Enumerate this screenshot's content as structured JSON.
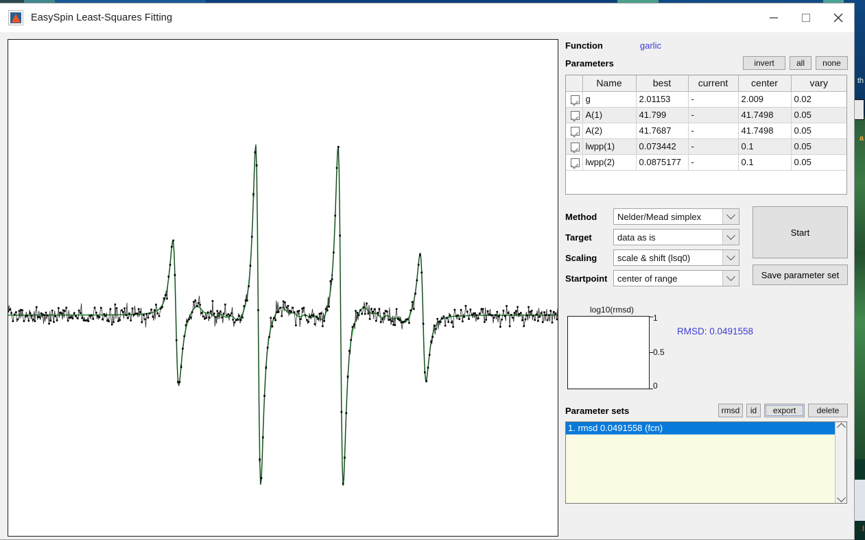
{
  "window": {
    "title": "EasySpin Least-Squares Fitting",
    "minimize_label": "minimize-button",
    "maximize_label": "maximize-button",
    "close_label": "close-button"
  },
  "right": {
    "function_label": "Function",
    "function_value": "garlic",
    "parameters_label": "Parameters",
    "param_buttons": {
      "invert": "invert",
      "all": "all",
      "none": "none"
    },
    "table": {
      "headers": [
        "",
        "Name",
        "best",
        "current",
        "center",
        "vary"
      ],
      "rows": [
        {
          "checked": true,
          "name": "g",
          "best": "2.01153",
          "current": "-",
          "center": "2.009",
          "vary": "0.02"
        },
        {
          "checked": true,
          "name": "A(1)",
          "best": "41.799",
          "current": "-",
          "center": "41.7498",
          "vary": "0.05"
        },
        {
          "checked": true,
          "name": "A(2)",
          "best": "41.7687",
          "current": "-",
          "center": "41.7498",
          "vary": "0.05"
        },
        {
          "checked": true,
          "name": "lwpp(1)",
          "best": "0.073442",
          "current": "-",
          "center": "0.1",
          "vary": "0.05"
        },
        {
          "checked": true,
          "name": "lwpp(2)",
          "best": "0.0875177",
          "current": "-",
          "center": "0.1",
          "vary": "0.05"
        }
      ]
    },
    "controls": [
      {
        "label": "Method",
        "value": "Nelder/Mead simplex"
      },
      {
        "label": "Target",
        "value": "data as is"
      },
      {
        "label": "Scaling",
        "value": "scale & shift (lsq0)"
      },
      {
        "label": "Startpoint",
        "value": "center of range"
      }
    ],
    "start_button": "Start",
    "save_button": "Save parameter set",
    "rmsd": {
      "plot_title": "log10(rmsd)",
      "tick_top": "1",
      "tick_mid": "0.5",
      "tick_bottom": "0",
      "readout": "RMSD: 0.0491558",
      "readout_color": "#3b3bd4"
    },
    "parameter_sets": {
      "label": "Parameter sets",
      "buttons": {
        "rmsd": "rmsd",
        "id": "id",
        "export": "export",
        "delete": "delete"
      },
      "items": [
        "1. rmsd 0.0491558 (fcn)"
      ],
      "selected_index": 0,
      "selected_color": "#0a7ada"
    }
  },
  "chart_data": {
    "type": "line",
    "title": "",
    "xlabel": "",
    "ylabel": "",
    "grid": false,
    "legend": "none",
    "series": [
      {
        "name": "experimental data",
        "style": "noisy-markers",
        "color": "#000000",
        "marker": "square",
        "description": "Noisy EPR derivative spectrum, four hyperfine lines"
      },
      {
        "name": "fit",
        "style": "smooth-line",
        "color": "#1e8f2e",
        "description": "Simulated garlic fit overlaid on data"
      }
    ],
    "xlim": [
      0,
      1
    ],
    "ylim": [
      -1.05,
      1.05
    ],
    "peaks": [
      {
        "center": 0.305,
        "positive_amplitude": 0.42,
        "negative_amplitude": -0.6
      },
      {
        "center": 0.455,
        "positive_amplitude": 1.0,
        "negative_amplitude": -1.0
      },
      {
        "center": 0.605,
        "positive_amplitude": 1.0,
        "negative_amplitude": -1.0
      },
      {
        "center": 0.755,
        "positive_amplitude": 0.33,
        "negative_amplitude": -0.5
      }
    ],
    "baseline": 0.0,
    "noise_level": 0.035
  },
  "desktop": {
    "note_text_1": "th",
    "note_text_2": "a",
    "note_text_3": "l"
  }
}
